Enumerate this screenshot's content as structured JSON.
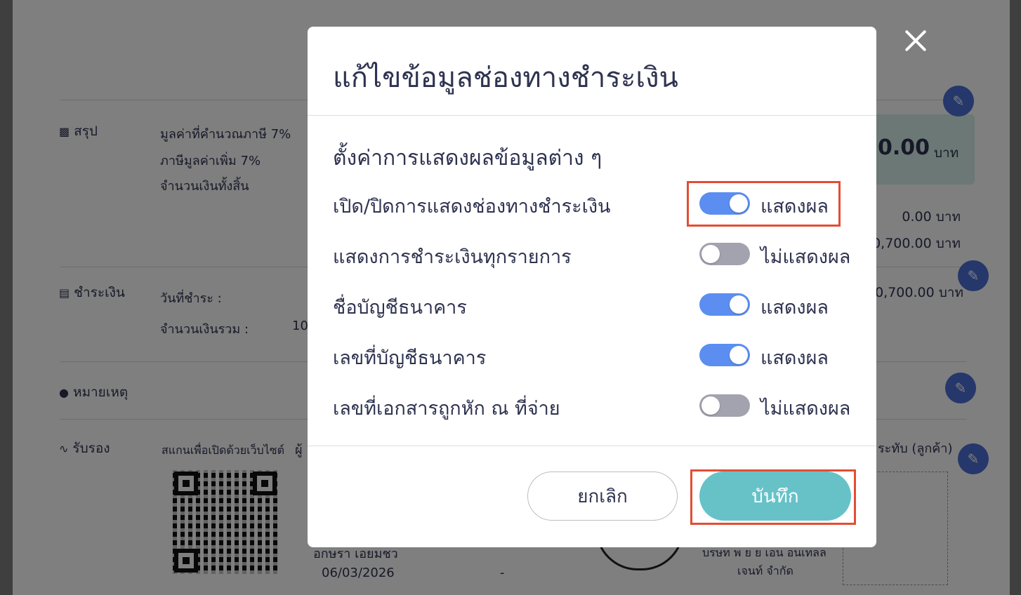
{
  "background": {
    "summary": {
      "title": "สรุป",
      "rows": [
        "มูลค่าที่คำนวณภาษี 7%",
        "ภาษีมูลค่าเพิ่ม 7%",
        "จำนวนเงินทั้งสิ้น"
      ],
      "total_big": "0.00",
      "total_unit": "บาท",
      "value_1": "0.00 บาท",
      "value_2": "0,700.00 บาท"
    },
    "payment": {
      "title": "ชำระเงิน",
      "date_label": "วันที่ชำระ :",
      "amount_label": "จำนวนเงินรวม :",
      "amount_value": "10",
      "total": "0,700.00 บาท"
    },
    "notes": {
      "title": "หมายเหตุ"
    },
    "certify": {
      "title": "รับรอง",
      "scan_label": "สแกนเพื่อเปิดด้วยเว็บไซต์",
      "scan_label_extra": "ผู้",
      "stamp_label": "ระทับ (ลูกค้า)",
      "signer_name": "อกษรา เอยมชว",
      "signer_date": "06/03/2026",
      "dash": "-",
      "company": "บรษท พ ย ย เอน อนเทลล",
      "company_2": "เจนท์ จำกัด"
    }
  },
  "modal": {
    "title": "แก้ไขข้อมูลช่องทางชำระเงิน",
    "section_title": "ตั้งค่าการแสดงผลข้อมูลต่าง ๆ",
    "toggles": [
      {
        "label": "เปิด/ปิดการแสดงช่องทางชำระเงิน",
        "state": "on",
        "status": "แสดงผล"
      },
      {
        "label": "แสดงการชำระเงินทุกรายการ",
        "state": "off",
        "status": "ไม่แสดงผล"
      },
      {
        "label": "ชื่อบัญชีธนาคาร",
        "state": "on",
        "status": "แสดงผล"
      },
      {
        "label": "เลขที่บัญชีธนาคาร",
        "state": "on",
        "status": "แสดงผล"
      },
      {
        "label": "เลขที่เอกสารถูกหัก ณ ที่จ่าย",
        "state": "off",
        "status": "ไม่แสดงผล"
      }
    ],
    "cancel_label": "ยกเลิก",
    "save_label": "บันทึก"
  },
  "colors": {
    "toggle_on": "#5b8ef0",
    "toggle_off": "#a3a3af",
    "save_button": "#67c2c8",
    "highlight": "#e34d34",
    "edit_button": "#4a6fd6"
  },
  "icons": {
    "close": "close-icon",
    "edit": "pencil-icon",
    "summary": "clipboard-icon",
    "payment": "money-icon",
    "notes": "chat-icon",
    "certify": "signature-icon"
  }
}
